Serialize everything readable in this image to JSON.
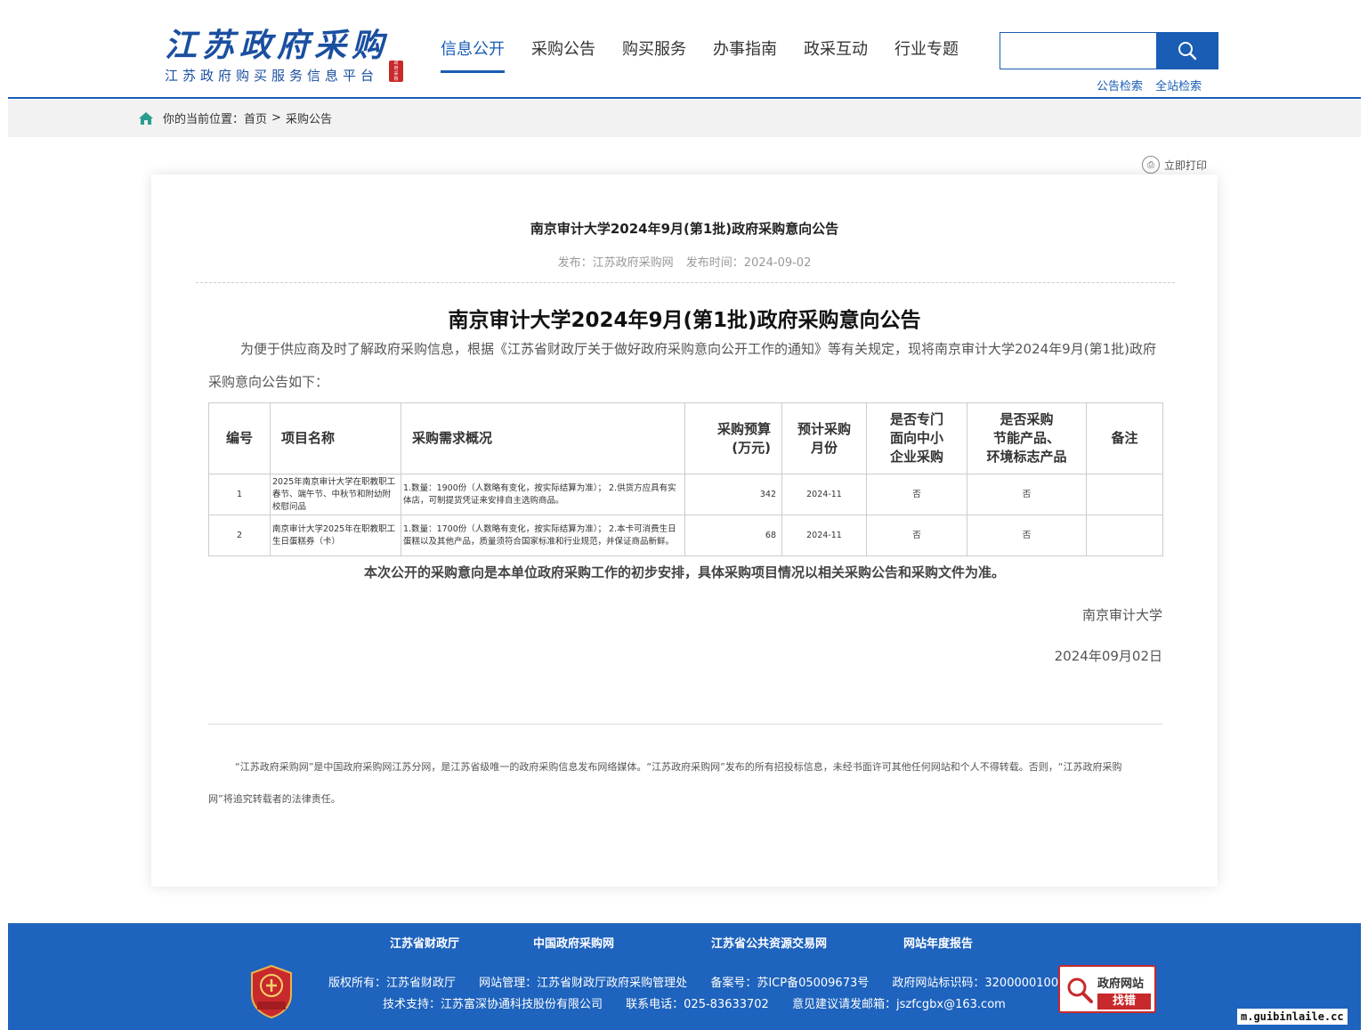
{
  "header": {
    "logo_script": "江苏政府采购",
    "logo_subtitle": "江苏政府购买服务信息平台",
    "logo_seal": "政府采购",
    "nav": [
      "信息公开",
      "采购公告",
      "购买服务",
      "办事指南",
      "政采互动",
      "行业专题"
    ],
    "active_nav": "信息公开",
    "search": {
      "value": "",
      "placeholder": ""
    },
    "search_links": [
      "公告检索",
      "全站检索"
    ]
  },
  "breadcrumb": {
    "label": "你的当前位置：",
    "home": "首页",
    "separator": ">",
    "current": "采购公告"
  },
  "print_label": "立即打印",
  "article": {
    "title": "南京审计大学2024年9月(第1批)政府采购意向公告",
    "publisher": "发布：江苏政府采购网",
    "publish_time": "发布时间：2024-09-02",
    "doc_title": "南京审计大学2024年9月(第1批)政府采购意向公告",
    "intro": "为便于供应商及时了解政府采购信息，根据《江苏省财政厅关于做好政府采购意向公开工作的通知》等有关规定，现将南京审计大学2024年9月(第1批)政府采购意向公告如下：",
    "table": {
      "headers": [
        "编号",
        "项目名称",
        "采购需求概况",
        "采购预算\n(万元)",
        "预计采购\n月份",
        "是否专门\n面向中小\n企业采购",
        "是否采购\n节能产品、\n环境标志产品",
        "备注"
      ],
      "rows": [
        [
          "1",
          "2025年南京审计大学在职教职工春节、端午节、中秋节和附幼附校慰问品",
          "1.数量：1900份（人数略有变化，按实际结算为准）； 2.供货方应具有实体店，可制提货凭证来安排自主选购商品。",
          "342",
          "2024-11",
          "否",
          "否",
          ""
        ],
        [
          "2",
          "南京审计大学2025年在职教职工生日蛋糕券（卡）",
          "1.数量：1700份（人数略有变化，按实际结算为准）； 2.本卡可消费生日蛋糕以及其他产品，质量须符合国家标准和行业规范，并保证商品新鲜。",
          "68",
          "2024-11",
          "否",
          "否",
          ""
        ]
      ]
    },
    "notice": "本次公开的采购意向是本单位政府采购工作的初步安排，具体采购项目情况以相关采购公告和采购文件为准。",
    "sign_org": "南京审计大学",
    "sign_date": "2024年09月02日",
    "disclaimer": "“江苏政府采购网”是中国政府采购网江苏分网，是江苏省级唯一的政府采购信息发布网络媒体。“江苏政府采购网”发布的所有招投标信息，未经书面许可其他任何网站和个人不得转载。否则，“江苏政府采购网”将追究转载者的法律责任。"
  },
  "footer": {
    "links": [
      "江苏省财政厅",
      "中国政府采购网",
      "江苏省公共资源交易网",
      "网站年度报告"
    ],
    "badge_text": "党政机关",
    "line1": [
      "版权所有：江苏省财政厅",
      "网站管理：江苏省财政厅政府采购管理处",
      "备案号：苏ICP备05009673号",
      "政府网站标识码：3200000100"
    ],
    "line2": [
      "技术支持：江苏富深协通科技股份有限公司",
      "联系电话：025-83633702",
      "意见建议请发邮箱：jszfcgbx@163.com"
    ],
    "find_error_top": "政府网站",
    "find_error_bottom": "找错"
  },
  "watermark": "m.guibinlaile.cc",
  "colors": {
    "brand_blue": "#1a5db4",
    "footer_blue": "#1e63bd",
    "seal_red": "#c8292c"
  }
}
